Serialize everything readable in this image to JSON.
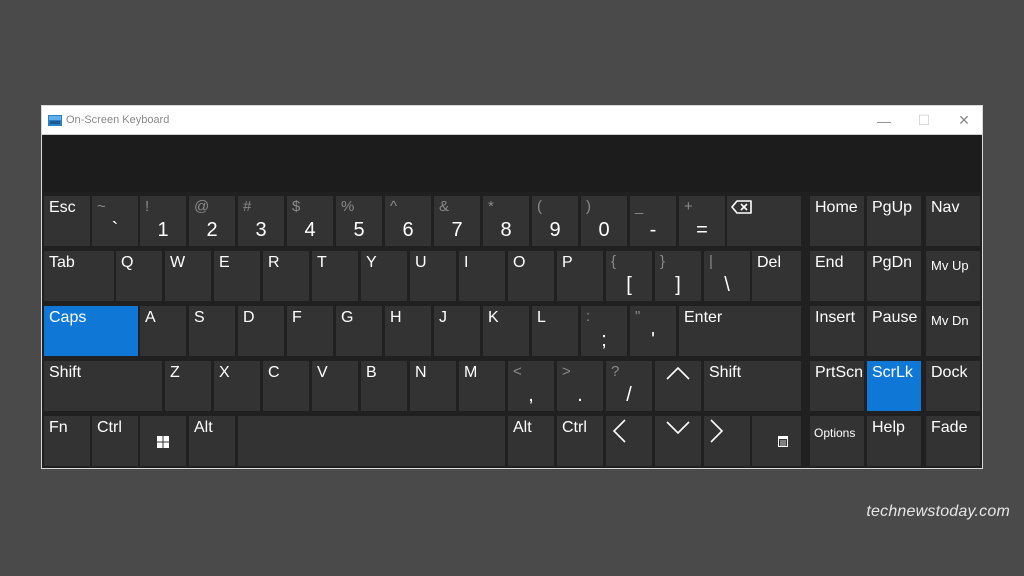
{
  "window": {
    "title": "On-Screen Keyboard",
    "minimize_glyph": "—",
    "maximize_glyph": "☐",
    "close_glyph": "✕"
  },
  "colors": {
    "background": "#4a4a4a",
    "key": "#333333",
    "active_key": "#0f78d7",
    "text": "#ffffff",
    "secondary_text": "#8a8a8a"
  },
  "active_keys": [
    "Caps",
    "ScrLk"
  ],
  "keys": {
    "esc": "Esc",
    "tilde": "~",
    "backtick": "`",
    "excl": "!",
    "one": "1",
    "at": "@",
    "two": "2",
    "hash": "#",
    "three": "3",
    "dollar": "$",
    "four": "4",
    "percent": "%",
    "five": "5",
    "caret": "^",
    "six": "6",
    "amp": "&",
    "seven": "7",
    "star": "*",
    "eight": "8",
    "lparen": "(",
    "nine": "9",
    "rparen": ")",
    "zero": "0",
    "underscore": "_",
    "minus": "-",
    "plus": "+",
    "equals": "=",
    "backspace_icon": "backspace-icon",
    "tab": "Tab",
    "q": "Q",
    "w": "W",
    "e": "E",
    "r": "R",
    "t": "T",
    "y": "Y",
    "u": "U",
    "i": "I",
    "o": "O",
    "p": "P",
    "lbrace": "{",
    "lbracket": "[",
    "rbrace": "}",
    "rbracket": "]",
    "pipe": "|",
    "backslash": "\\",
    "del": "Del",
    "caps": "Caps",
    "a": "A",
    "s": "S",
    "d": "D",
    "f": "F",
    "g": "G",
    "h": "H",
    "j": "J",
    "k": "K",
    "l": "L",
    "colon": ":",
    "semicolon": ";",
    "dquote": "\"",
    "squote": "'",
    "enter": "Enter",
    "lshift": "Shift",
    "z": "Z",
    "x": "X",
    "c": "C",
    "v": "V",
    "b": "B",
    "n": "N",
    "m": "M",
    "lt": "<",
    "comma": ",",
    "gt": ">",
    "period": ".",
    "question": "?",
    "slash": "/",
    "rshift": "Shift",
    "fn": "Fn",
    "lctrl": "Ctrl",
    "win_icon": "windows-icon",
    "lalt": "Alt",
    "ralt": "Alt",
    "rctrl": "Ctrl",
    "home": "Home",
    "pgup": "PgUp",
    "nav": "Nav",
    "end": "End",
    "pgdn": "PgDn",
    "mvup": "Mv Up",
    "insert": "Insert",
    "pause": "Pause",
    "mvdn": "Mv Dn",
    "prtscn": "PrtScn",
    "scrlk": "ScrLk",
    "dock": "Dock",
    "options": "Options",
    "help": "Help",
    "fade": "Fade"
  },
  "watermark": "technewstoday.com"
}
